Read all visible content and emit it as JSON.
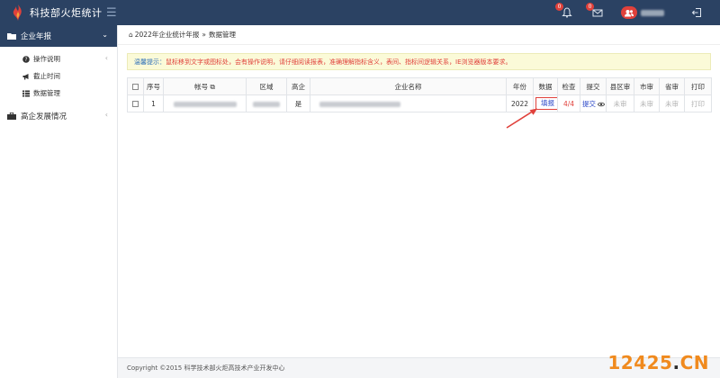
{
  "header": {
    "title": "科技部火炬统计",
    "notifications_count": "0",
    "messages_count": "0",
    "colors": {
      "bar": "#2b4263",
      "badge": "#e0413b"
    }
  },
  "sidebar": {
    "groups": [
      {
        "label": "企业年报",
        "active": true,
        "items": [
          {
            "label": "操作说明",
            "icon": "question-circle-icon"
          },
          {
            "label": "截止时间",
            "icon": "megaphone-icon"
          },
          {
            "label": "数据管理",
            "icon": "list-icon"
          }
        ]
      },
      {
        "label": "高企发展情况",
        "active": false,
        "items": []
      }
    ]
  },
  "breadcrumb": {
    "section": "2022年企业统计年报",
    "separator": "»",
    "page": "数据管理"
  },
  "tip": {
    "label": "温馨提示：",
    "text": "鼠标移到文字或图标处，会有操作说明，请仔细阅读报表，准确理解指标含义，表间、指标间逻辑关系，IE浏览器版本要求。"
  },
  "table": {
    "columns": [
      "序号",
      "帐号",
      "区域",
      "高企",
      "企业名称",
      "年份",
      "数据",
      "检查",
      "提交",
      "县区审",
      "市审",
      "省审",
      "打印"
    ],
    "rows": [
      {
        "index": "1",
        "high_tech": "是",
        "year": "2022",
        "data_action": "填报",
        "check": "4/4",
        "submit": "提交",
        "county_review": "未审",
        "city_review": "未审",
        "province_review": "未审",
        "print": "打印"
      }
    ]
  },
  "footer": {
    "copyright": "Copyright ©2015 科学技术部火炬高技术产业开发中心"
  },
  "watermark": {
    "main": "12425",
    "dot": ".",
    "suffix": "CN"
  }
}
